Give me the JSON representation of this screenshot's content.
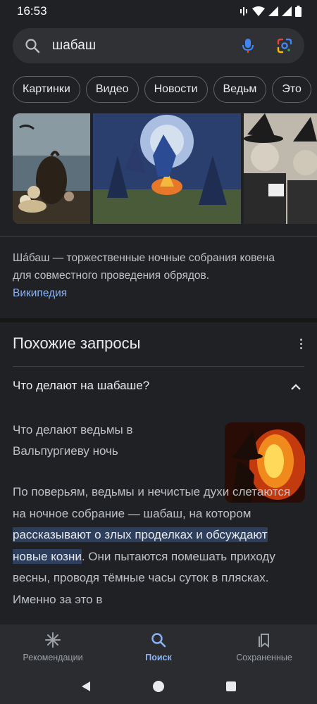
{
  "status_bar": {
    "time": "16:53"
  },
  "search": {
    "query": "шабаш"
  },
  "chips": [
    {
      "label": "Картинки"
    },
    {
      "label": "Видео"
    },
    {
      "label": "Новости"
    },
    {
      "label": "Ведьм"
    },
    {
      "label": "Это"
    }
  ],
  "knowledge": {
    "text": "Ша́баш — торжественные ночные собрания ковена для совместного проведения обрядов.",
    "source": "Википедия"
  },
  "related": {
    "title": "Похожие запросы",
    "question": "Что делают на шабаше?",
    "answer_title": "Что делают ведьмы в Вальпургиеву ночь",
    "answer_before": "По поверьям, ведьмы и нечистые духи слетаются на ночное собрание — шабаш, на котором ",
    "answer_highlight": "рассказывают о злых проделках и обсуждают новые козни",
    "answer_after": ". Они пытаются помешать приходу весны, проводя тёмные часы суток в плясках. Именно за это в"
  },
  "bottom_nav": {
    "recommendations": "Рекомендации",
    "search": "Поиск",
    "saved": "Сохраненные"
  },
  "colors": {
    "background": "#202124",
    "link": "#8ab4f8",
    "highlight": "#2d3f5c"
  }
}
